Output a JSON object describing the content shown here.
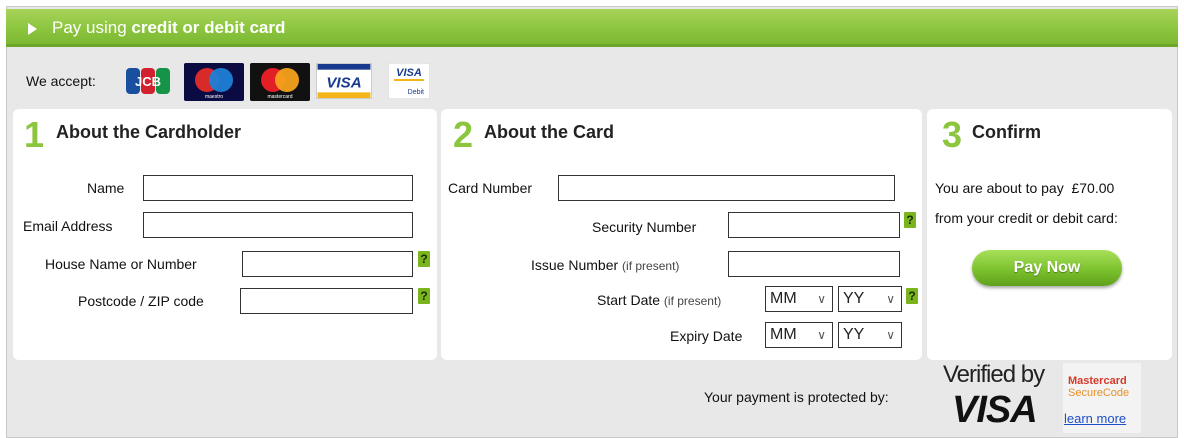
{
  "header": {
    "prefix": "Pay using",
    "bold": "credit or debit card"
  },
  "accept": {
    "label": "We accept:",
    "logos": [
      "jcb-logo",
      "maestro-logo",
      "mastercard-logo",
      "visa-logo",
      "visa-debit-logo"
    ]
  },
  "cardholder": {
    "number": "1",
    "title": "About the Cardholder",
    "name_label": "Name",
    "name_value": "",
    "email_label": "Email Address",
    "email_value": "",
    "house_label": "House Name or Number",
    "house_value": "",
    "postcode_label": "Postcode / ZIP code",
    "postcode_value": ""
  },
  "card": {
    "number": "2",
    "title": "About the Card",
    "card_number_label": "Card Number",
    "card_number_value": "",
    "security_label": "Security Number",
    "security_value": "",
    "issue_label": "Issue Number",
    "issue_note": "(if present)",
    "issue_value": "",
    "start_label": "Start Date",
    "start_note": "(if present)",
    "start_month": "MM",
    "start_year": "YY",
    "expiry_label": "Expiry Date",
    "expiry_month": "MM",
    "expiry_year": "YY"
  },
  "confirm": {
    "number": "3",
    "title": "Confirm",
    "line1": "You are about to pay  £70.00",
    "line2": "from your credit or debit card:",
    "button": "Pay Now"
  },
  "help_icon": "?",
  "footer": {
    "protected": "Your payment is protected by:",
    "verified_by": "Verified by",
    "verified_visa": "VISA",
    "mc_title": "Mastercard",
    "mc_sub": "SecureCode",
    "learn_more": "learn more"
  },
  "colors": {
    "brand_green": "#8cc63f",
    "panel_grey": "#e8e8e8",
    "link_blue": "#1e4fc8"
  }
}
